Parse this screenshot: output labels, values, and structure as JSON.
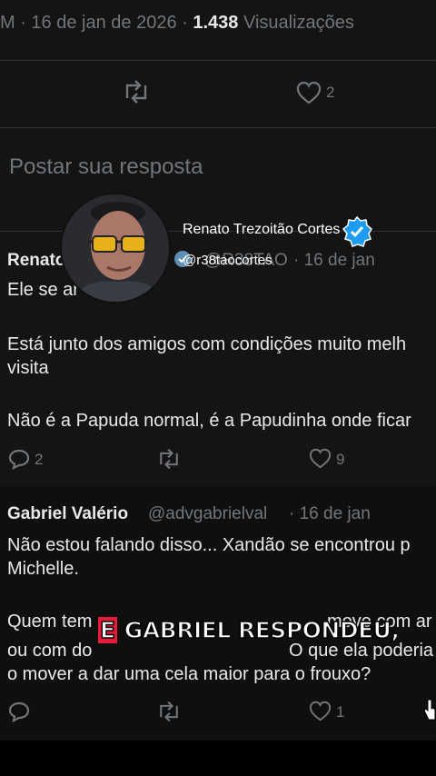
{
  "header": {
    "meta_prefix": "M · 16 de jan de 2026 · ",
    "views_count": "1.438",
    "views_label": "Visualizações",
    "like_count": "2"
  },
  "reply_box": {
    "placeholder": "Postar sua resposta"
  },
  "overlay": {
    "channel_name": "Renato Trezoitão Cortes",
    "channel_handle": "@r38taocortes",
    "caption_highlight": "E",
    "caption_rest": "GABRIEL RESPONDEU,"
  },
  "reply1": {
    "author": "Renato",
    "handle": "@R38TAO",
    "date": "· 16 de jan",
    "line1": "Ele se ar",
    "line2": "Está junto dos amigos com condições muito melh",
    "line3": "visita",
    "line4": "Não é a Papuda normal, é a Papudinha onde ficar",
    "reply_count": "2",
    "like_count": "9"
  },
  "reply2": {
    "author": "Gabriel Valério",
    "handle": "@advgabrielval",
    "date": "· 16 de jan",
    "line1": "Não estou falando disso... Xandão se encontrou p",
    "line2": "Michelle.",
    "line3a": "Quem tem",
    "line3b": "move com ar",
    "line4a": "ou com do",
    "line4b": "O que ela poderia",
    "line5": "o mover a dar uma cela maior para o frouxo?",
    "like_count": "1"
  }
}
